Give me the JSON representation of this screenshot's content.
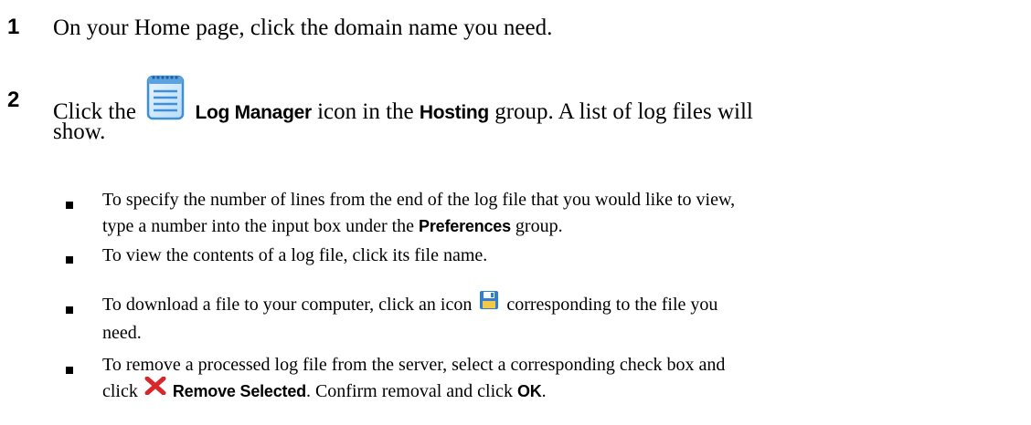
{
  "steps": [
    {
      "number": "1",
      "text": "On your Home page, click the domain name you need."
    },
    {
      "number": "2",
      "before": "Click the",
      "icon": "log-manager-notepad-icon",
      "term1": "Log Manager",
      "mid": "icon in the",
      "term2": "Hosting",
      "after": "group. A list of log files will",
      "after2": "show."
    }
  ],
  "bullets": [
    {
      "line1": "To specify the number of lines from the end of the log file that you would like to view,",
      "line2_before": "type a number into the input box under the",
      "term": "Preferences",
      "line2_after": "group."
    },
    {
      "text": "To view the contents of a log file, click its file name."
    },
    {
      "before": "To download a file to your computer, click an icon",
      "icon": "save-floppy-icon",
      "after": "corresponding to the file you",
      "line2": "need."
    },
    {
      "line1": "To remove a processed log file from the server, select a corresponding check box and",
      "line2_before": "click",
      "icon": "remove-x-icon",
      "term1": "Remove Selected",
      "mid": ". Confirm removal and click",
      "term2": "OK",
      "end": "."
    }
  ],
  "colors": {
    "icon_blue": "#3d8fd6",
    "remove_red": "#d8262b",
    "save_blue": "#2f7fd1"
  }
}
